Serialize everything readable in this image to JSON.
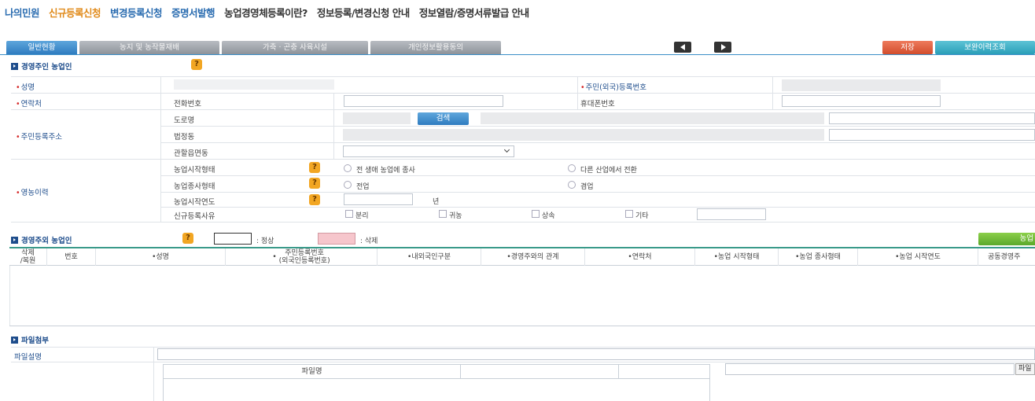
{
  "topnav": {
    "items": [
      {
        "label": "나의민원",
        "color": "#2a6cb0"
      },
      {
        "label": "신규등록신청",
        "color": "#e08a1a"
      },
      {
        "label": "변경등록신청",
        "color": "#2a6cb0"
      },
      {
        "label": "증명서발행",
        "color": "#2a6cb0"
      },
      {
        "label": "농업경영체등록이란?",
        "color": "#333333"
      },
      {
        "label": "정보등록/변경신청 안내",
        "color": "#333333"
      },
      {
        "label": "정보열람/증명서류발급 안내",
        "color": "#333333"
      }
    ]
  },
  "tabs": {
    "general": "일반현황",
    "farmland": "농지 및 농작물재배",
    "livestock": "가축 · 곤충 사육시설",
    "privacy": "개인정보활용동의",
    "save": "저장",
    "history": "보완이력조회"
  },
  "section1": {
    "title": "경영주인 농업인",
    "help": "?",
    "name_label": "성명",
    "resident_label": "주민(외국)등록번호",
    "contact_label": "연락처",
    "phone_label": "전화번호",
    "mobile_label": "휴대폰번호",
    "address_label": "주민등록주소",
    "road_label": "도로명",
    "search_button": "검색",
    "legal_dong_label": "법정동",
    "jurisdiction_label": "관할읍면동",
    "career_label": "영농이력",
    "start_type_label": "농업시작형태",
    "start_type_opt1": "전 생애 농업에 종사",
    "start_type_opt2": "다른 산업에서 전환",
    "work_type_label": "농업종사형태",
    "work_type_opt1": "전업",
    "work_type_opt2": "겸업",
    "start_year_label": "농업시작연도",
    "year_unit": "년",
    "reason_label": "신규등록사유",
    "reason_opts": [
      "분리",
      "귀농",
      "상속",
      "기타"
    ]
  },
  "section2": {
    "title": "경영주외 농업인",
    "help": "?",
    "legend_normal": ": 정상",
    "legend_deleted": ": 삭제",
    "add_button": "농업",
    "columns": [
      {
        "label": "삭제\n/복원",
        "req": false
      },
      {
        "label": "번호",
        "req": false
      },
      {
        "label": "성명",
        "req": true
      },
      {
        "label": "주민등록번호\n(외국인등록번호)",
        "req": true
      },
      {
        "label": "내외국인구분",
        "req": true
      },
      {
        "label": "경영주와의 관계",
        "req": true
      },
      {
        "label": "연락처",
        "req": true
      },
      {
        "label": "농업 시작형태",
        "req": true
      },
      {
        "label": "농업 종사형태",
        "req": true
      },
      {
        "label": "농업 시작연도",
        "req": true
      },
      {
        "label": "공동경영주",
        "req": false
      }
    ]
  },
  "section3": {
    "title": "파일첨부",
    "desc_label": "파일설명",
    "filename_header": "파일명",
    "file_button": "파일"
  },
  "colors": {
    "accent_blue": "#2f7cc0",
    "save_red": "#d24d2c",
    "history_teal": "#2a9fb8",
    "help_orange": "#f2a623",
    "deleted_pink": "#f6c6cc",
    "green": "#5aa82a"
  }
}
